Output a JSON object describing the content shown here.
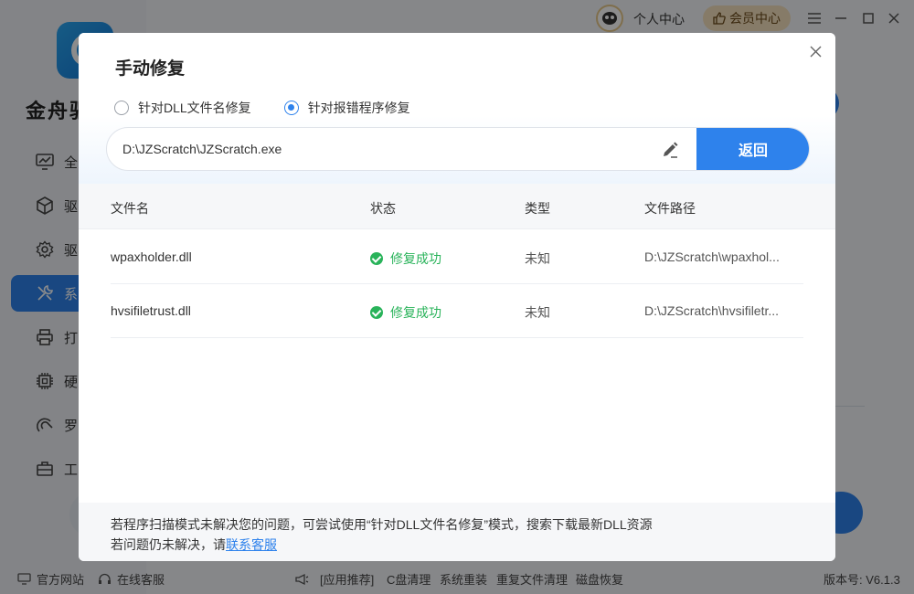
{
  "app": {
    "brand": "金舟驱",
    "nav": [
      {
        "label": "全",
        "icon": "monitor-icon",
        "active": false
      },
      {
        "label": "驱",
        "icon": "cube-icon",
        "active": false
      },
      {
        "label": "驱",
        "icon": "gear-cog-icon",
        "active": false
      },
      {
        "label": "系",
        "icon": "tools-icon",
        "active": true
      },
      {
        "label": "打",
        "icon": "printer-icon",
        "active": false
      },
      {
        "label": "硬",
        "icon": "chip-icon",
        "active": false
      },
      {
        "label": "罗",
        "icon": "controller-icon",
        "active": false
      },
      {
        "label": "工",
        "icon": "toolbox-icon",
        "active": false
      }
    ],
    "topbar": {
      "personal_center": "个人中心",
      "vip_center": "会员中心"
    },
    "bottom": {
      "official_site": "官方网站",
      "online_service": "在线客服",
      "recommend": "[应用推荐]",
      "links": [
        "C盘清理",
        "系统重装",
        "重复文件清理",
        "磁盘恢复"
      ],
      "version": "版本号: V6.1.3"
    }
  },
  "dialog": {
    "title": "手动修复",
    "radios": [
      {
        "label": "针对DLL文件名修复",
        "checked": false
      },
      {
        "label": "针对报错程序修复",
        "checked": true
      }
    ],
    "path_value": "D:\\JZScratch\\JZScratch.exe",
    "return_label": "返回",
    "columns": [
      "文件名",
      "状态",
      "类型",
      "文件路径"
    ],
    "rows": [
      {
        "name": "wpaxholder.dll",
        "status": "修复成功",
        "type": "未知",
        "path": "D:\\JZScratch\\wpaxhol..."
      },
      {
        "name": "hvsifiletrust.dll",
        "status": "修复成功",
        "type": "未知",
        "path": "D:\\JZScratch\\hvsifiletr..."
      }
    ],
    "footer": {
      "line1": "若程序扫描模式未解决您的问题，可尝试使用“针对DLL文件名修复”模式，搜索下载最新DLL资源",
      "line2_prefix": "若问题仍未解决，请",
      "line2_link": "联系客服"
    }
  }
}
